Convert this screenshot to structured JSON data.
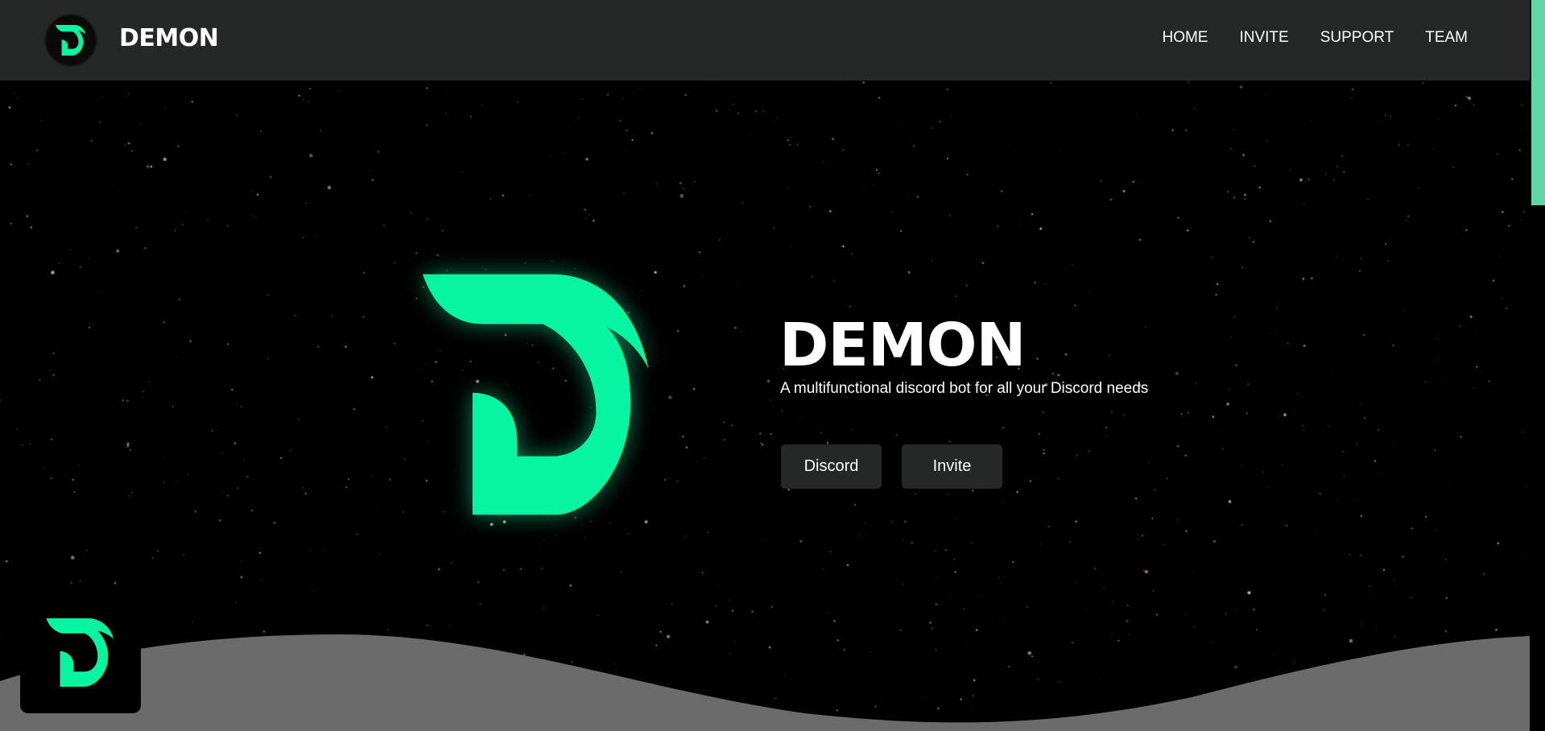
{
  "nav": {
    "brand": "DEMON",
    "links": [
      "HOME",
      "INVITE",
      "SUPPORT",
      "TEAM"
    ]
  },
  "hero": {
    "title": "DEMON",
    "subtitle": "A multifunctional discord bot for all your Discord needs",
    "buttons": {
      "discord": "Discord",
      "invite": "Invite"
    }
  },
  "icons": {
    "logo": "demon-d-logo-icon"
  },
  "colors": {
    "accent": "#07f5a0",
    "navbar": "#262828",
    "button": "#262828",
    "wave": "#6b6b6b",
    "scrollbar": "#5fd6a5",
    "background": "#000000"
  }
}
